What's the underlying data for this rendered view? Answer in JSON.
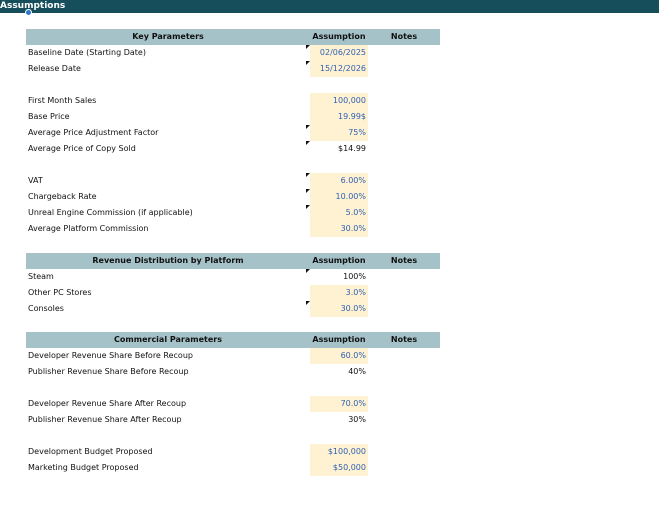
{
  "sheet": {
    "title": "Assumptions"
  },
  "key": {
    "header": {
      "label": "Key Parameters",
      "assumption": "Assumption",
      "notes": "Notes"
    },
    "rows": [
      {
        "label": "Baseline Date (Starting Date)",
        "value": "02/06/2025"
      },
      {
        "label": "Release Date",
        "value": "15/12/2026"
      },
      {
        "label": "First Month Sales",
        "value": "100,000"
      },
      {
        "label": "Base Price",
        "value": "19.99$"
      },
      {
        "label": "Average Price Adjustment Factor",
        "value": "75%"
      },
      {
        "label": "Average Price of Copy Sold",
        "value": "$14.99"
      },
      {
        "label": "VAT",
        "value": "6.00%"
      },
      {
        "label": "Chargeback Rate",
        "value": "10.00%"
      },
      {
        "label": "Unreal Engine Commission (if applicable)",
        "value": "5.0%"
      },
      {
        "label": "Average Platform Commission",
        "value": "30.0%"
      }
    ]
  },
  "revenue": {
    "header": {
      "label": "Revenue Distribution by Platform",
      "assumption": "Assumption",
      "notes": "Notes"
    },
    "rows": [
      {
        "label": "Steam",
        "value": "100%"
      },
      {
        "label": "Other PC Stores",
        "value": "3.0%"
      },
      {
        "label": "Consoles",
        "value": "30.0%"
      }
    ]
  },
  "commercial": {
    "header": {
      "label": "Commercial Parameters",
      "assumption": "Assumption",
      "notes": "Notes"
    },
    "rows": [
      {
        "label": "Developer Revenue Share Before Recoup",
        "value": "60.0%"
      },
      {
        "label": "Publisher Revenue Share Before Recoup",
        "value": "40%"
      },
      {
        "label": "Developer Revenue Share After Recoup",
        "value": "70.0%"
      },
      {
        "label": "Publisher Revenue Share After Recoup",
        "value": "30%"
      },
      {
        "label": "Development Budget Proposed",
        "value": "$100,000"
      },
      {
        "label": "Marketing Budget Proposed",
        "value": "$50,000"
      }
    ]
  },
  "colors": {
    "title_bar": "#174e5b",
    "header_fill": "#a5c2c9",
    "input_fill": "#fff2d2",
    "input_text": "#2f5fb2"
  }
}
